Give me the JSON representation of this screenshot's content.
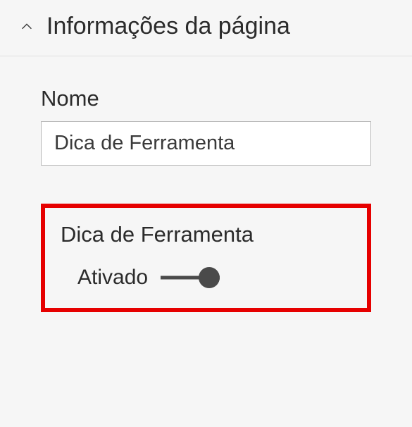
{
  "section": {
    "title": "Informações da página"
  },
  "name_field": {
    "label": "Nome",
    "value": "Dica de Ferramenta"
  },
  "tooltip_section": {
    "label": "Dica de Ferramenta",
    "toggle_state": "Ativado"
  }
}
